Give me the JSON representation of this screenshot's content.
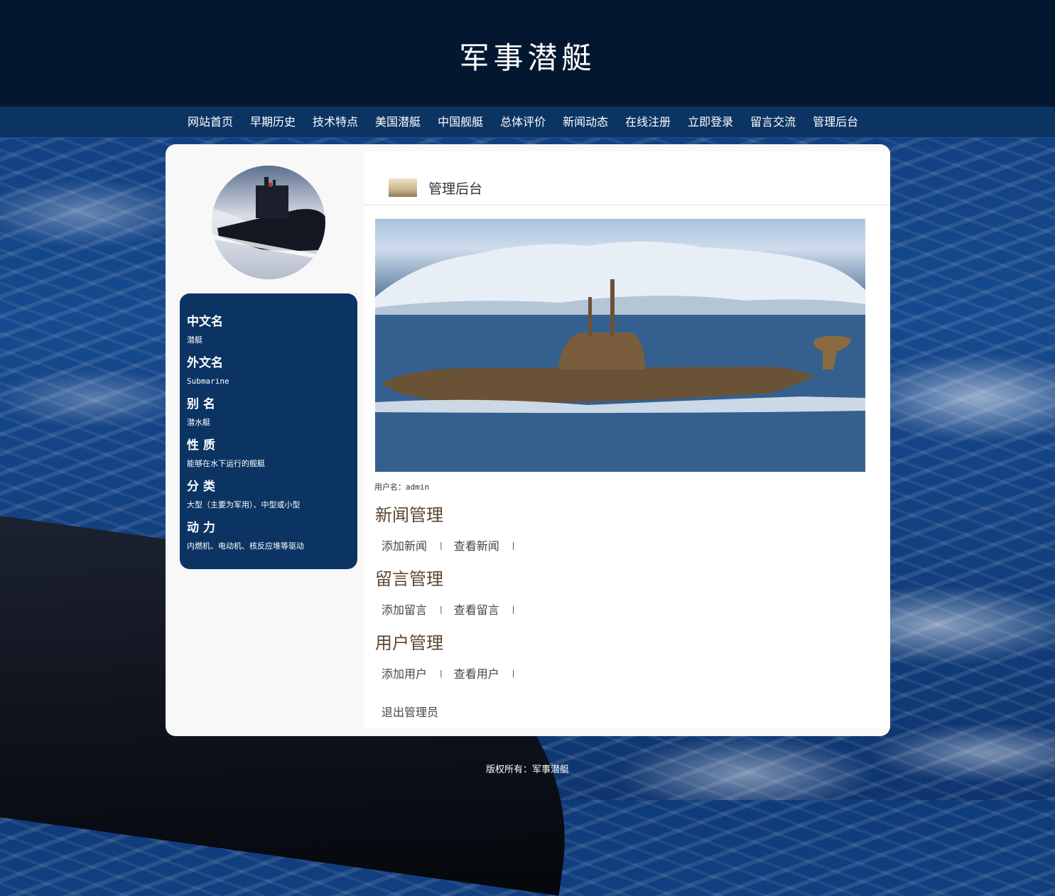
{
  "header": {
    "title": "军事潜艇"
  },
  "nav": {
    "items": [
      "网站首页",
      "早期历史",
      "技术特点",
      "美国潜艇",
      "中国舰艇",
      "总体评价",
      "新闻动态",
      "在线注册",
      "立即登录",
      "留言交流",
      "管理后台"
    ]
  },
  "sidebar": {
    "info": [
      {
        "key": "中文名",
        "value": "潜艇"
      },
      {
        "key": "外文名",
        "value": "Submarine"
      },
      {
        "key": "别 名",
        "value": "潜水艇"
      },
      {
        "key": "性 质",
        "value": "能够在水下运行的舰艇"
      },
      {
        "key": "分 类",
        "value": "大型（主要为军用）、中型或小型"
      },
      {
        "key": "动 力",
        "value": "内燃机、电动机、核反应堆等驱动"
      }
    ]
  },
  "content": {
    "title": "管理后台",
    "username": "用户名：admin",
    "sections": [
      {
        "title": "新闻管理",
        "links": [
          "添加新闻",
          "查看新闻"
        ]
      },
      {
        "title": "留言管理",
        "links": [
          "添加留言",
          "查看留言"
        ]
      },
      {
        "title": "用户管理",
        "links": [
          "添加用户",
          "查看用户"
        ]
      }
    ],
    "separator": "|",
    "logout": "退出管理员"
  },
  "footer": {
    "text": "版权所有：军事潜艇"
  },
  "colors": {
    "header_bg": "#031830",
    "nav_bg": "#0b3463",
    "info_bg": "#0b3463",
    "section_title": "#5a4632"
  }
}
